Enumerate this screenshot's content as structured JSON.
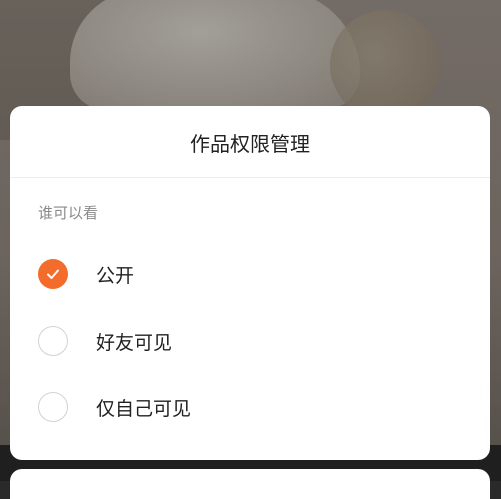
{
  "dialog": {
    "title": "作品权限管理",
    "section_label": "谁可以看",
    "options": [
      {
        "label": "公开",
        "selected": true
      },
      {
        "label": "好友可见",
        "selected": false
      },
      {
        "label": "仅自己可见",
        "selected": false
      }
    ]
  },
  "colors": {
    "accent": "#f46c2b",
    "sheet_background": "#ffffff",
    "title_text": "#222222",
    "secondary_text": "#8a8a8a"
  },
  "icons": {
    "selected": "check-icon"
  }
}
